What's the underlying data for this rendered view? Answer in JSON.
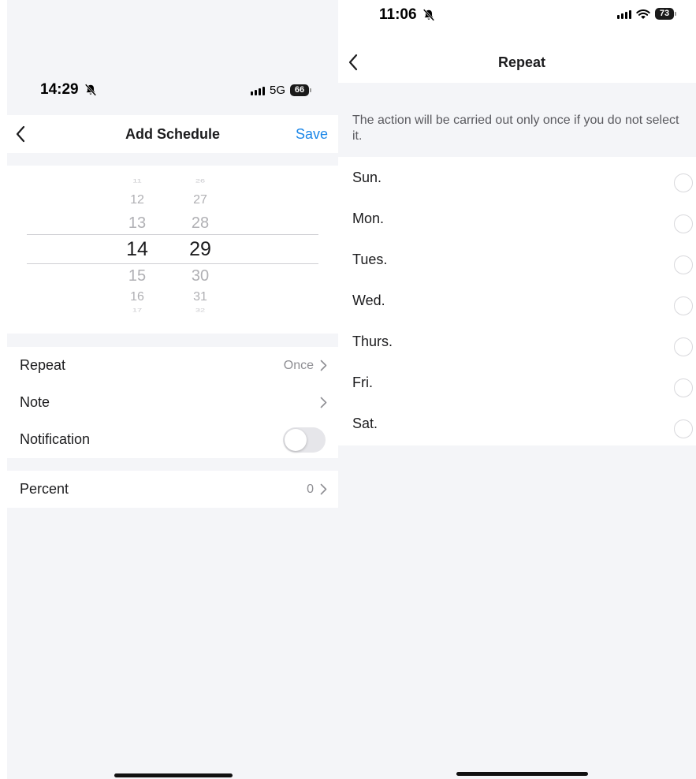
{
  "left_screen": {
    "status": {
      "time": "14:29",
      "network": "5G",
      "battery": "66"
    },
    "header": {
      "title": "Add Schedule",
      "save_label": "Save"
    },
    "picker": {
      "hours": [
        "11",
        "12",
        "13",
        "14",
        "15",
        "16",
        "17"
      ],
      "minutes": [
        "26",
        "27",
        "28",
        "29",
        "30",
        "31",
        "32"
      ],
      "selected_hour": "14",
      "selected_minute": "29"
    },
    "settings": {
      "repeat_label": "Repeat",
      "repeat_value": "Once",
      "note_label": "Note",
      "notification_label": "Notification",
      "notification_on": false,
      "percent_label": "Percent",
      "percent_value": "0"
    }
  },
  "right_screen": {
    "status": {
      "time": "11:06",
      "battery": "73"
    },
    "header": {
      "title": "Repeat"
    },
    "note": "The action will be carried out only once if you do not select it.",
    "days": [
      {
        "label": "Sun.",
        "selected": false
      },
      {
        "label": "Mon.",
        "selected": false
      },
      {
        "label": "Tues.",
        "selected": false
      },
      {
        "label": "Wed.",
        "selected": false
      },
      {
        "label": "Thurs.",
        "selected": false
      },
      {
        "label": "Fri.",
        "selected": false
      },
      {
        "label": "Sat.",
        "selected": false
      }
    ]
  },
  "icons": [
    "bell-slash-icon",
    "signal-icon",
    "wifi-icon",
    "battery-icon",
    "back-chevron-icon",
    "chevron-right-icon",
    "radio-circle-icon"
  ],
  "colors": {
    "accent": "#1a86e8",
    "background": "#f4f5f8",
    "text": "#1c1c1e",
    "secondary": "#8e8e93"
  }
}
